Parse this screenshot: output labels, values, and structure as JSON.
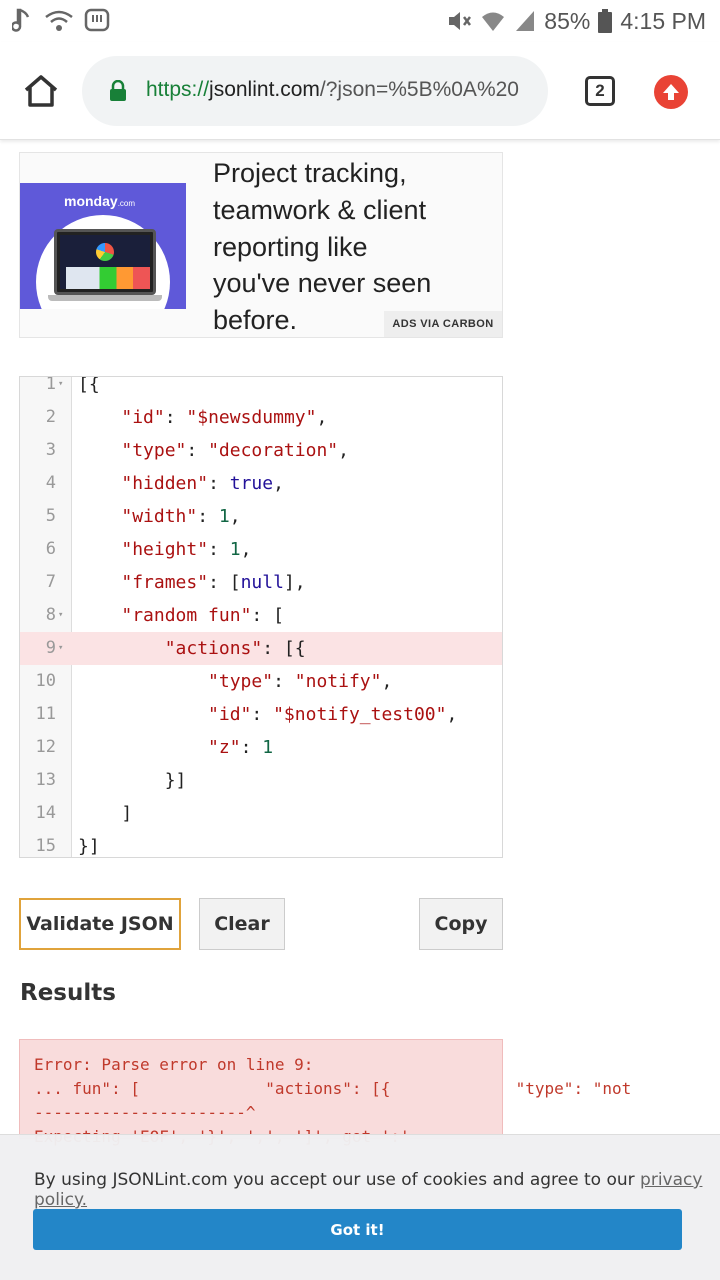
{
  "status_bar": {
    "battery": "85%",
    "time": "4:15 PM",
    "icons_left": [
      "music-note-icon",
      "wifi-icon",
      "message-icon"
    ],
    "icons_right": [
      "mute-icon",
      "wifi-icon",
      "signal-icon",
      "battery-icon"
    ]
  },
  "browser": {
    "url_protocol": "https://",
    "url_host": "jsonlint.com",
    "url_path": "/?json=%5B%0A%20",
    "tab_count": "2",
    "accent_update": "#e94335",
    "lock_color": "#188038"
  },
  "ad": {
    "logo_text": "monday",
    "logo_suffix": ".com",
    "text": "Project tracking, teamwork & client reporting like you've never seen before.",
    "via_label": "ADS VIA CARBON"
  },
  "editor": {
    "lines": [
      {
        "n": "1",
        "fold": true
      },
      {
        "n": "2"
      },
      {
        "n": "3"
      },
      {
        "n": "4"
      },
      {
        "n": "5"
      },
      {
        "n": "6"
      },
      {
        "n": "7"
      },
      {
        "n": "8",
        "fold": true
      },
      {
        "n": "9",
        "fold": true,
        "error": true
      },
      {
        "n": "10"
      },
      {
        "n": "11"
      },
      {
        "n": "12"
      },
      {
        "n": "13"
      },
      {
        "n": "14"
      },
      {
        "n": "15"
      }
    ],
    "code": [
      "[{",
      "    \"id\": \"$newsdummy\",",
      "    \"type\": \"decoration\",",
      "    \"hidden\": true,",
      "    \"width\": 1,",
      "    \"height\": 1,",
      "    \"frames\": [null],",
      "    \"random fun\": [",
      "        \"actions\": [{",
      "            \"type\": \"notify\",",
      "            \"id\": \"$notify_test00\",",
      "            \"z\": 1",
      "        }]",
      "    ]",
      "}]"
    ]
  },
  "buttons": {
    "validate": "Validate JSON",
    "clear": "Clear",
    "copy": "Copy"
  },
  "results": {
    "title": "Results",
    "error_lines": [
      "Error: Parse error on line 9:",
      "... fun\": [             \"actions\": [{             \"type\": \"not",
      "----------------------^",
      "Expecting 'EOF', '}', ',', ']', got ':'"
    ]
  },
  "cookie": {
    "text": "By using JSONLint.com you accept our use of cookies and agree to our ",
    "link": "privacy policy.",
    "button": "Got it!"
  }
}
